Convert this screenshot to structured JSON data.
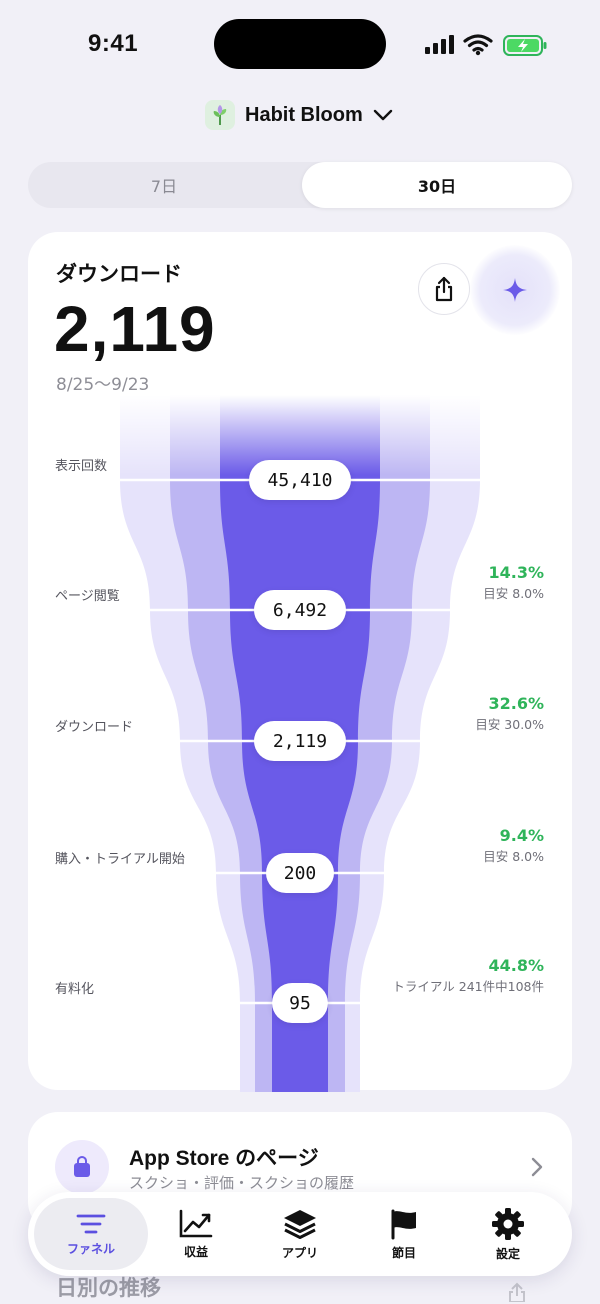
{
  "status": {
    "time": "9:41"
  },
  "app": {
    "name": "Habit Bloom"
  },
  "period": {
    "options": [
      "7日",
      "30日"
    ],
    "selected": "30日"
  },
  "metric": {
    "title": "ダウンロード",
    "value": "2,119",
    "range": "8/25〜9/23"
  },
  "funnel": {
    "stages": [
      {
        "label": "表示回数",
        "value": "45,410"
      },
      {
        "label": "ページ閲覧",
        "value": "6,492",
        "rate": "14.3%",
        "note": "目安 8.0%"
      },
      {
        "label": "ダウンロード",
        "value": "2,119",
        "rate": "32.6%",
        "note": "目安 30.0%"
      },
      {
        "label": "購入・トライアル開始",
        "value": "200",
        "rate": "9.4%",
        "note": "目安 8.0%"
      },
      {
        "label": "有料化",
        "value": "95",
        "rate": "44.8%",
        "note": "トライアル 241件中108件"
      }
    ],
    "colors": {
      "inner": "#6b5be8",
      "middle": "#b9b2f2",
      "outer": "#e3e0fa",
      "rate": "#2fb45a"
    }
  },
  "store": {
    "title": "App Store のページ",
    "subtitle": "スクショ・評価・スクショの履歴"
  },
  "daily": {
    "title": "日別の推移"
  },
  "tabs": [
    {
      "label": "ファネル",
      "icon": "funnel-lines-icon",
      "active": true
    },
    {
      "label": "収益",
      "icon": "chart-line-icon"
    },
    {
      "label": "アプリ",
      "icon": "layers-icon"
    },
    {
      "label": "節目",
      "icon": "flag-icon"
    },
    {
      "label": "設定",
      "icon": "gear-icon"
    }
  ],
  "accent": "#5b4fe0"
}
